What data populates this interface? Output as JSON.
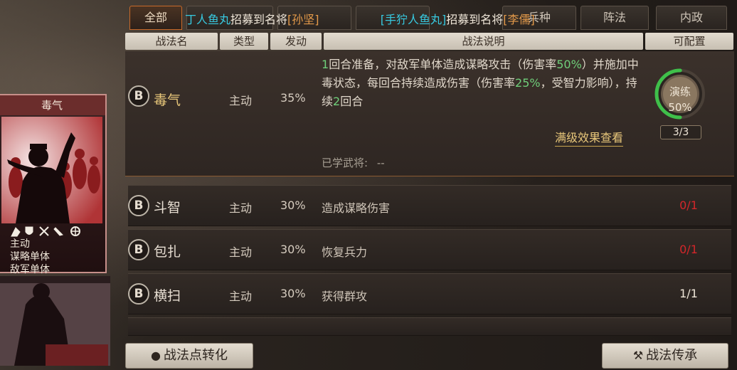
{
  "tabs": [
    {
      "label": "全部",
      "active": true
    },
    {
      "label": "",
      "active": false
    },
    {
      "label": "",
      "active": false
    },
    {
      "label": "",
      "active": false
    },
    {
      "label": "兵种",
      "active": false
    },
    {
      "label": "阵法",
      "active": false
    },
    {
      "label": "内政",
      "active": false
    }
  ],
  "ticker": [
    {
      "prefix": "丁人鱼丸",
      "mid": "招募到名将",
      "hero": "[孙坚]"
    },
    {
      "prefix": "[手狞人鱼丸]",
      "mid": "招募到名将",
      "hero": "[李儒]"
    }
  ],
  "headers": {
    "name": "战法名",
    "type": "类型",
    "trigger": "发动",
    "desc": "战法说明",
    "config": "可配置"
  },
  "expanded": {
    "grade": "B",
    "name": "毒气",
    "type": "主动",
    "rate": "35%",
    "desc_parts": [
      {
        "t": "1",
        "c": "green"
      },
      {
        "t": "回合准备，对敌军单体造成谋略攻击（伤害率",
        "c": ""
      },
      {
        "t": "50%",
        "c": "green"
      },
      {
        "t": "）并施加中毒状态，每回合持续造成伤害（伤害率",
        "c": ""
      },
      {
        "t": "25%",
        "c": "green"
      },
      {
        "t": "，受智力影响），持续",
        "c": ""
      },
      {
        "t": "2",
        "c": "green"
      },
      {
        "t": "回合",
        "c": ""
      }
    ],
    "full_effect": "满级效果查看",
    "learned_label": "已学武将:",
    "learned_value": "--",
    "practice_label": "演练",
    "practice_percent": "50%",
    "practice_fraction": 0.5,
    "count": "3/3"
  },
  "rows": [
    {
      "grade": "B",
      "name": "斗智",
      "type": "主动",
      "rate": "30%",
      "desc": "造成谋略伤害",
      "config": "0/1",
      "config_color": "red"
    },
    {
      "grade": "B",
      "name": "包扎",
      "type": "主动",
      "rate": "30%",
      "desc": "恢复兵力",
      "config": "0/1",
      "config_color": "red"
    },
    {
      "grade": "B",
      "name": "横扫",
      "type": "主动",
      "rate": "30%",
      "desc": "获得群攻",
      "config": "1/1",
      "config_color": "white"
    }
  ],
  "card": {
    "title": "毒气",
    "lines": [
      "主动",
      "谋略单体",
      "敌军单体"
    ]
  },
  "buttons": {
    "convert": "战法点转化",
    "inherit": "战法传承"
  },
  "colors": {
    "accent_orange": "#c86a2a",
    "highlight_green": "#6fcf7a",
    "config_red": "#d4262a",
    "ring_green": "#3fbf4a"
  }
}
